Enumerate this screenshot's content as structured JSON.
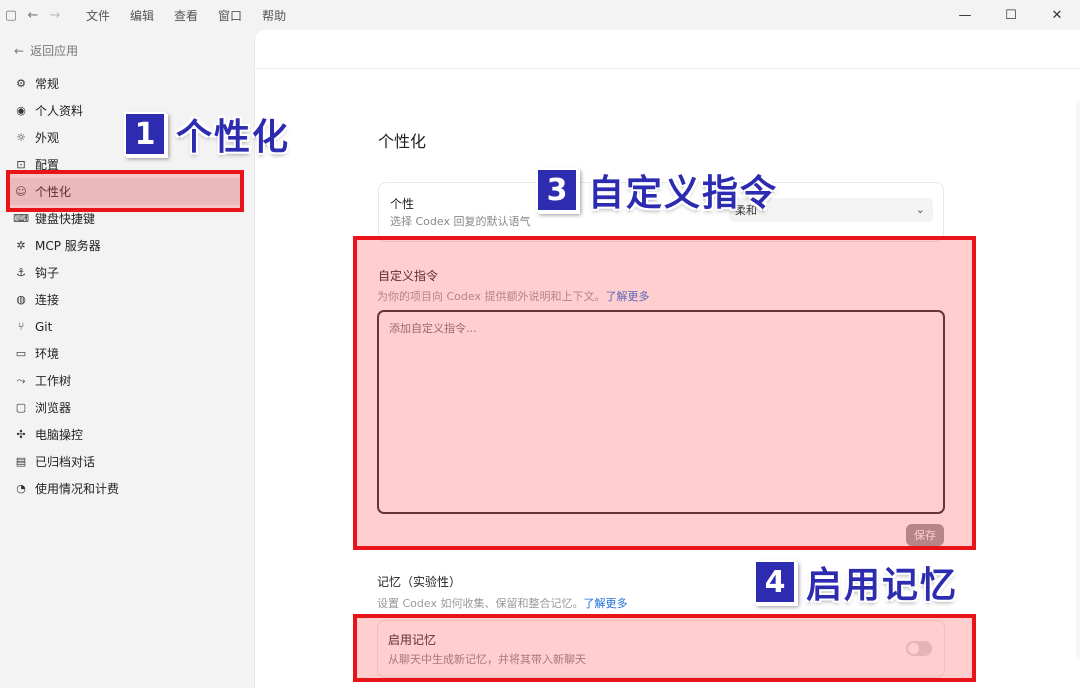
{
  "titlebar": {
    "menu": [
      "文件",
      "编辑",
      "查看",
      "窗口",
      "帮助"
    ]
  },
  "sidebar": {
    "back_label": "返回应用",
    "items": [
      {
        "label": "常规",
        "icon": "gear-icon"
      },
      {
        "label": "个人资料",
        "icon": "user-icon"
      },
      {
        "label": "外观",
        "icon": "sun-icon"
      },
      {
        "label": "配置",
        "icon": "config-icon"
      },
      {
        "label": "个性化",
        "icon": "smile-icon"
      },
      {
        "label": "键盘快捷键",
        "icon": "keyboard-icon"
      },
      {
        "label": "MCP 服务器",
        "icon": "mcp-icon"
      },
      {
        "label": "钩子",
        "icon": "anchor-icon"
      },
      {
        "label": "连接",
        "icon": "globe-icon"
      },
      {
        "label": "Git",
        "icon": "git-icon"
      },
      {
        "label": "环境",
        "icon": "monitor-icon"
      },
      {
        "label": "工作树",
        "icon": "tree-icon"
      },
      {
        "label": "浏览器",
        "icon": "browser-icon"
      },
      {
        "label": "电脑操控",
        "icon": "control-icon"
      },
      {
        "label": "已归档对话",
        "icon": "archive-icon"
      },
      {
        "label": "使用情况和计费",
        "icon": "usage-icon"
      }
    ],
    "active_index": 4
  },
  "main": {
    "page_title": "个性化",
    "personality": {
      "title": "个性",
      "description": "选择 Codex 回复的默认语气",
      "selected": "柔和"
    },
    "custom_instructions": {
      "title": "自定义指令",
      "description": "为你的项目向 Codex 提供额外说明和上下文。",
      "link": "了解更多",
      "placeholder": "添加自定义指令...",
      "save_label": "保存"
    },
    "memory": {
      "title": "记忆（实验性）",
      "description": "设置 Codex 如何收集、保留和整合记忆。",
      "link": "了解更多",
      "card_title": "启用记忆",
      "card_description": "从聊天中生成新记忆，并将其带入新聊天",
      "enabled": false
    }
  },
  "annotations": {
    "a1": {
      "num": "1",
      "text": "个性化"
    },
    "a3": {
      "num": "3",
      "text": "自定义指令"
    },
    "a4": {
      "num": "4",
      "text": "启用记忆"
    }
  },
  "colors": {
    "highlight_border": "#e8141a",
    "label_blue": "#2d2bb0",
    "link": "#1a6fe0"
  }
}
